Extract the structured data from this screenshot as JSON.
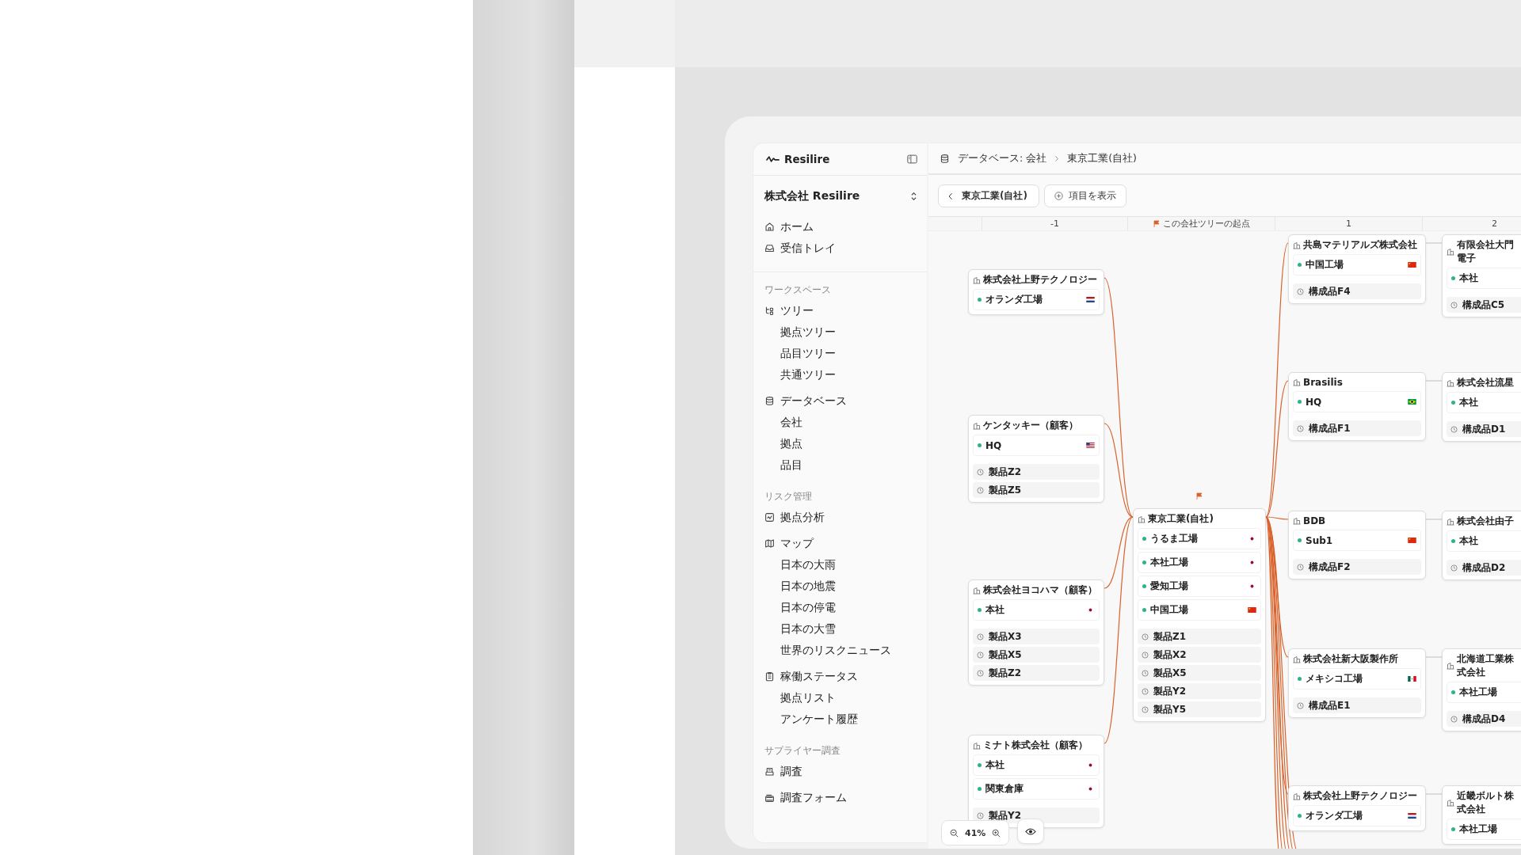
{
  "sidebar": {
    "brand": "Resilire",
    "company": "株式会社 Resilire",
    "groups": [
      {
        "items": [
          {
            "label": "ホーム",
            "kind": "home"
          },
          {
            "label": "受信トレイ",
            "kind": "inbox"
          }
        ]
      },
      {
        "title": "ワークスペース",
        "items": [
          {
            "label": "ツリー",
            "kind": "tree",
            "children": [
              {
                "label": "拠点ツリー"
              },
              {
                "label": "品目ツリー"
              },
              {
                "label": "共通ツリー"
              }
            ]
          },
          {
            "label": "データベース",
            "kind": "database",
            "children": [
              {
                "label": "会社"
              },
              {
                "label": "拠点"
              },
              {
                "label": "品目"
              }
            ]
          }
        ]
      },
      {
        "title": "リスク管理",
        "items": [
          {
            "label": "拠点分析",
            "kind": "chart"
          },
          {
            "label": "マップ",
            "kind": "map",
            "children": [
              {
                "label": "日本の大雨"
              },
              {
                "label": "日本の地震"
              },
              {
                "label": "日本の停電"
              },
              {
                "label": "日本の大雪"
              },
              {
                "label": "世界のリスクニュース"
              }
            ]
          },
          {
            "label": "稼働ステータス",
            "kind": "clipboard",
            "children": [
              {
                "label": "拠点リスト"
              },
              {
                "label": "アンケート履歴"
              }
            ]
          }
        ]
      },
      {
        "title": "サプライヤー調査",
        "items": [
          {
            "label": "調査",
            "kind": "survey"
          },
          {
            "label": "調査フォーム",
            "kind": "form"
          }
        ]
      }
    ]
  },
  "breadcrumb": [
    "データベース: 会社",
    "東京工業(自社)"
  ],
  "toolbar": {
    "back_button": "東京工業(自社)",
    "show_items_button": "項目を表示"
  },
  "columns": [
    {
      "label": "-1",
      "kind": "plain"
    },
    {
      "label": "この会社ツリーの起点",
      "kind": "origin"
    },
    {
      "label": "1",
      "kind": "plain"
    },
    {
      "label": "2",
      "kind": "plain"
    }
  ],
  "tree": {
    "upstream": [
      {
        "title": "株式会社上野テクノロジー",
        "sites": [
          {
            "name": "オランダ工場",
            "kind": "nl"
          }
        ]
      },
      {
        "title": "ケンタッキー（顧客）",
        "sites": [
          {
            "name": "HQ",
            "kind": "us"
          }
        ],
        "products": [
          {
            "name": "製品Z2"
          },
          {
            "name": "製品Z5"
          }
        ]
      },
      {
        "title": "株式会社ヨコハマ（顧客）",
        "sites": [
          {
            "name": "本社",
            "kind": "jp"
          }
        ],
        "products": [
          {
            "name": "製品X3"
          },
          {
            "name": "製品X5"
          },
          {
            "name": "製品Z2"
          }
        ]
      },
      {
        "title": "ミナト株式会社（顧客）",
        "sites": [
          {
            "name": "本社",
            "kind": "jp"
          },
          {
            "name": "関東倉庫",
            "kind": "jp"
          }
        ],
        "products": [
          {
            "name": "製品Y2"
          }
        ]
      }
    ],
    "origin": {
      "title": "東京工業(自社)",
      "sites": [
        {
          "name": "うるま工場",
          "kind": "jp"
        },
        {
          "name": "本社工場",
          "kind": "jp"
        },
        {
          "name": "愛知工場",
          "kind": "jp"
        },
        {
          "name": "中国工場",
          "kind": "cn"
        }
      ],
      "products": [
        {
          "name": "製品Z1"
        },
        {
          "name": "製品X2"
        },
        {
          "name": "製品X5"
        },
        {
          "name": "製品Y2"
        },
        {
          "name": "製品Y5"
        }
      ]
    },
    "downstream_1": [
      {
        "title": "共島マテリアルズ株式会社",
        "sites": [
          {
            "name": "中国工場",
            "kind": "cn"
          }
        ],
        "products": [
          {
            "name": "構成品F4"
          }
        ]
      },
      {
        "title": "Brasilis",
        "sites": [
          {
            "name": "HQ",
            "kind": "br"
          }
        ],
        "products": [
          {
            "name": "構成品F1"
          }
        ]
      },
      {
        "title": "BDB",
        "sites": [
          {
            "name": "Sub1",
            "kind": "cn"
          }
        ],
        "products": [
          {
            "name": "構成品F2"
          }
        ]
      },
      {
        "title": "株式会社新大阪製作所",
        "sites": [
          {
            "name": "メキシコ工場",
            "kind": "mx"
          }
        ],
        "products": [
          {
            "name": "構成品E1"
          }
        ]
      },
      {
        "title": "株式会社上野テクノロジー",
        "sites": [
          {
            "name": "オランダ工場",
            "kind": "nl"
          }
        ]
      }
    ],
    "downstream_2": [
      {
        "title": "有限会社大門電子",
        "sites": [
          {
            "name": "本社"
          }
        ],
        "products": [
          {
            "name": "構成品C5"
          }
        ]
      },
      {
        "title": "株式会社流星",
        "sites": [
          {
            "name": "本社"
          }
        ],
        "products": [
          {
            "name": "構成品D1"
          }
        ]
      },
      {
        "title": "株式会社由子",
        "sites": [
          {
            "name": "本社"
          }
        ],
        "products": [
          {
            "name": "構成品D2"
          }
        ]
      },
      {
        "title": "北海道工業株式会社",
        "sites": [
          {
            "name": "本社工場"
          }
        ],
        "products": [
          {
            "name": "構成品D4"
          }
        ]
      },
      {
        "title": "近畿ボルト株式会社",
        "sites": [
          {
            "name": "本社工場"
          }
        ]
      }
    ]
  },
  "zoom": {
    "value": "41%"
  }
}
